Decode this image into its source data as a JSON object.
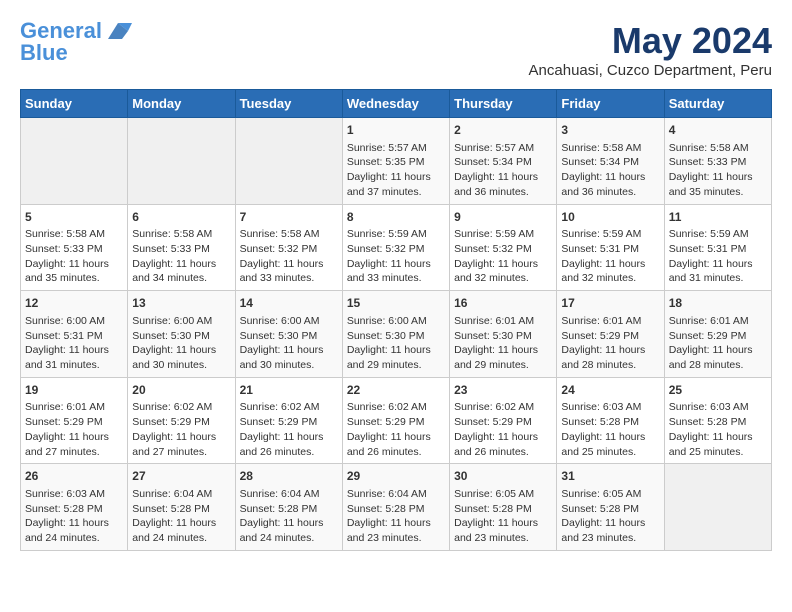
{
  "header": {
    "logo_line1": "General",
    "logo_line2": "Blue",
    "title": "May 2024",
    "subtitle": "Ancahuasi, Cuzco Department, Peru"
  },
  "days_of_week": [
    "Sunday",
    "Monday",
    "Tuesday",
    "Wednesday",
    "Thursday",
    "Friday",
    "Saturday"
  ],
  "weeks": [
    [
      {
        "day": "",
        "sunrise": "",
        "sunset": "",
        "daylight": ""
      },
      {
        "day": "",
        "sunrise": "",
        "sunset": "",
        "daylight": ""
      },
      {
        "day": "",
        "sunrise": "",
        "sunset": "",
        "daylight": ""
      },
      {
        "day": "1",
        "sunrise": "Sunrise: 5:57 AM",
        "sunset": "Sunset: 5:35 PM",
        "daylight": "Daylight: 11 hours and 37 minutes."
      },
      {
        "day": "2",
        "sunrise": "Sunrise: 5:57 AM",
        "sunset": "Sunset: 5:34 PM",
        "daylight": "Daylight: 11 hours and 36 minutes."
      },
      {
        "day": "3",
        "sunrise": "Sunrise: 5:58 AM",
        "sunset": "Sunset: 5:34 PM",
        "daylight": "Daylight: 11 hours and 36 minutes."
      },
      {
        "day": "4",
        "sunrise": "Sunrise: 5:58 AM",
        "sunset": "Sunset: 5:33 PM",
        "daylight": "Daylight: 11 hours and 35 minutes."
      }
    ],
    [
      {
        "day": "5",
        "sunrise": "Sunrise: 5:58 AM",
        "sunset": "Sunset: 5:33 PM",
        "daylight": "Daylight: 11 hours and 35 minutes."
      },
      {
        "day": "6",
        "sunrise": "Sunrise: 5:58 AM",
        "sunset": "Sunset: 5:33 PM",
        "daylight": "Daylight: 11 hours and 34 minutes."
      },
      {
        "day": "7",
        "sunrise": "Sunrise: 5:58 AM",
        "sunset": "Sunset: 5:32 PM",
        "daylight": "Daylight: 11 hours and 33 minutes."
      },
      {
        "day": "8",
        "sunrise": "Sunrise: 5:59 AM",
        "sunset": "Sunset: 5:32 PM",
        "daylight": "Daylight: 11 hours and 33 minutes."
      },
      {
        "day": "9",
        "sunrise": "Sunrise: 5:59 AM",
        "sunset": "Sunset: 5:32 PM",
        "daylight": "Daylight: 11 hours and 32 minutes."
      },
      {
        "day": "10",
        "sunrise": "Sunrise: 5:59 AM",
        "sunset": "Sunset: 5:31 PM",
        "daylight": "Daylight: 11 hours and 32 minutes."
      },
      {
        "day": "11",
        "sunrise": "Sunrise: 5:59 AM",
        "sunset": "Sunset: 5:31 PM",
        "daylight": "Daylight: 11 hours and 31 minutes."
      }
    ],
    [
      {
        "day": "12",
        "sunrise": "Sunrise: 6:00 AM",
        "sunset": "Sunset: 5:31 PM",
        "daylight": "Daylight: 11 hours and 31 minutes."
      },
      {
        "day": "13",
        "sunrise": "Sunrise: 6:00 AM",
        "sunset": "Sunset: 5:30 PM",
        "daylight": "Daylight: 11 hours and 30 minutes."
      },
      {
        "day": "14",
        "sunrise": "Sunrise: 6:00 AM",
        "sunset": "Sunset: 5:30 PM",
        "daylight": "Daylight: 11 hours and 30 minutes."
      },
      {
        "day": "15",
        "sunrise": "Sunrise: 6:00 AM",
        "sunset": "Sunset: 5:30 PM",
        "daylight": "Daylight: 11 hours and 29 minutes."
      },
      {
        "day": "16",
        "sunrise": "Sunrise: 6:01 AM",
        "sunset": "Sunset: 5:30 PM",
        "daylight": "Daylight: 11 hours and 29 minutes."
      },
      {
        "day": "17",
        "sunrise": "Sunrise: 6:01 AM",
        "sunset": "Sunset: 5:29 PM",
        "daylight": "Daylight: 11 hours and 28 minutes."
      },
      {
        "day": "18",
        "sunrise": "Sunrise: 6:01 AM",
        "sunset": "Sunset: 5:29 PM",
        "daylight": "Daylight: 11 hours and 28 minutes."
      }
    ],
    [
      {
        "day": "19",
        "sunrise": "Sunrise: 6:01 AM",
        "sunset": "Sunset: 5:29 PM",
        "daylight": "Daylight: 11 hours and 27 minutes."
      },
      {
        "day": "20",
        "sunrise": "Sunrise: 6:02 AM",
        "sunset": "Sunset: 5:29 PM",
        "daylight": "Daylight: 11 hours and 27 minutes."
      },
      {
        "day": "21",
        "sunrise": "Sunrise: 6:02 AM",
        "sunset": "Sunset: 5:29 PM",
        "daylight": "Daylight: 11 hours and 26 minutes."
      },
      {
        "day": "22",
        "sunrise": "Sunrise: 6:02 AM",
        "sunset": "Sunset: 5:29 PM",
        "daylight": "Daylight: 11 hours and 26 minutes."
      },
      {
        "day": "23",
        "sunrise": "Sunrise: 6:02 AM",
        "sunset": "Sunset: 5:29 PM",
        "daylight": "Daylight: 11 hours and 26 minutes."
      },
      {
        "day": "24",
        "sunrise": "Sunrise: 6:03 AM",
        "sunset": "Sunset: 5:28 PM",
        "daylight": "Daylight: 11 hours and 25 minutes."
      },
      {
        "day": "25",
        "sunrise": "Sunrise: 6:03 AM",
        "sunset": "Sunset: 5:28 PM",
        "daylight": "Daylight: 11 hours and 25 minutes."
      }
    ],
    [
      {
        "day": "26",
        "sunrise": "Sunrise: 6:03 AM",
        "sunset": "Sunset: 5:28 PM",
        "daylight": "Daylight: 11 hours and 24 minutes."
      },
      {
        "day": "27",
        "sunrise": "Sunrise: 6:04 AM",
        "sunset": "Sunset: 5:28 PM",
        "daylight": "Daylight: 11 hours and 24 minutes."
      },
      {
        "day": "28",
        "sunrise": "Sunrise: 6:04 AM",
        "sunset": "Sunset: 5:28 PM",
        "daylight": "Daylight: 11 hours and 24 minutes."
      },
      {
        "day": "29",
        "sunrise": "Sunrise: 6:04 AM",
        "sunset": "Sunset: 5:28 PM",
        "daylight": "Daylight: 11 hours and 23 minutes."
      },
      {
        "day": "30",
        "sunrise": "Sunrise: 6:05 AM",
        "sunset": "Sunset: 5:28 PM",
        "daylight": "Daylight: 11 hours and 23 minutes."
      },
      {
        "day": "31",
        "sunrise": "Sunrise: 6:05 AM",
        "sunset": "Sunset: 5:28 PM",
        "daylight": "Daylight: 11 hours and 23 minutes."
      },
      {
        "day": "",
        "sunrise": "",
        "sunset": "",
        "daylight": ""
      }
    ]
  ]
}
